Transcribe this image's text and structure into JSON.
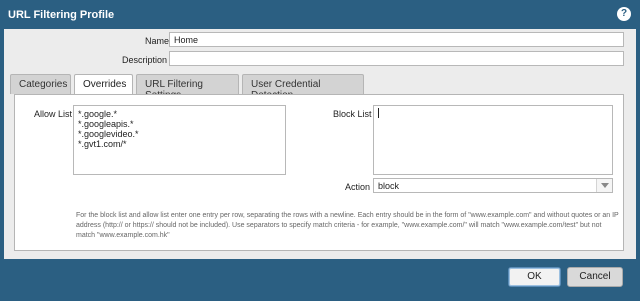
{
  "dialog": {
    "title": "URL Filtering Profile",
    "help_icon": "?"
  },
  "form": {
    "name_label": "Name",
    "name_value": "Home",
    "description_label": "Description",
    "description_value": ""
  },
  "tabs": [
    {
      "label": "Categories",
      "active": false
    },
    {
      "label": "Overrides",
      "active": true
    },
    {
      "label": "URL Filtering Settings",
      "active": false
    },
    {
      "label": "User Credential Detection",
      "active": false
    }
  ],
  "overrides": {
    "allow_list_label": "Allow List",
    "allow_list_value": "*.google.*\n*.googleapis.*\n*.googlevideo.*\n*.gvt1.com/*",
    "block_list_label": "Block List",
    "block_list_value": "",
    "action_label": "Action",
    "action_value": "block",
    "help_text": "For the block list and allow list enter one entry per row, separating the rows with a newline. Each entry should be in the form of \"www.example.com\" and without quotes or an IP address (http:// or https:// should not be included). Use separators to specify match criteria - for example, \"www.example.com/\" will match \"www.example.com/test\" but not match \"www.example.com.hk\""
  },
  "buttons": {
    "ok": "OK",
    "cancel": "Cancel"
  },
  "colors": {
    "chrome": "#2b5f82",
    "panel_bg": "#ececec"
  }
}
